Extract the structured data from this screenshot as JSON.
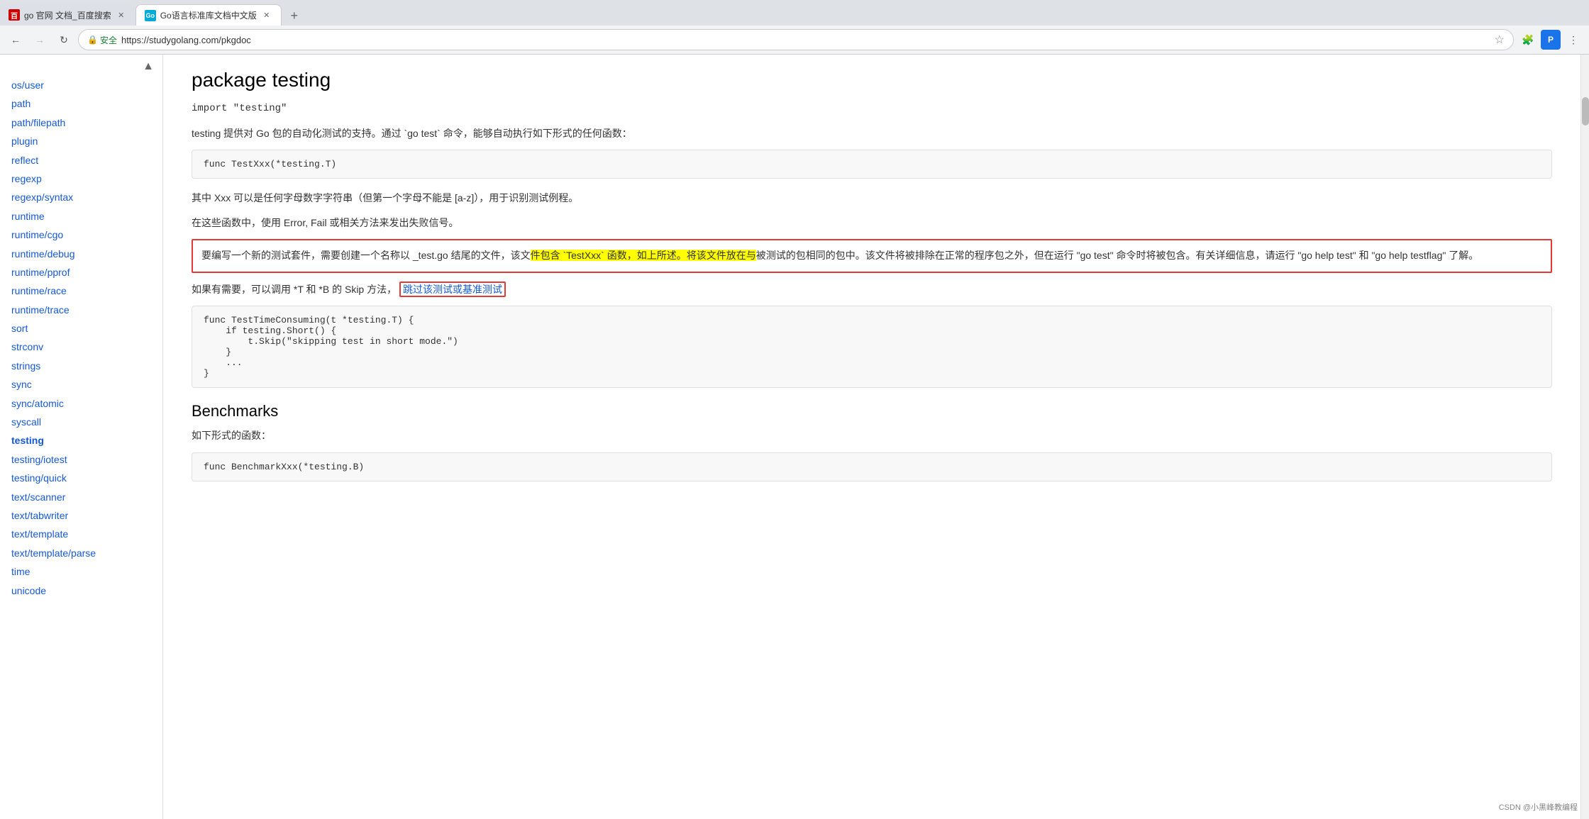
{
  "browser": {
    "tabs": [
      {
        "id": "tab1",
        "label": "go 官网 文档_百度搜索",
        "favicon_type": "baidu",
        "favicon_text": "百",
        "active": false
      },
      {
        "id": "tab2",
        "label": "Go语言标准库文档中文版",
        "favicon_type": "go",
        "favicon_text": "Go",
        "active": true
      }
    ],
    "nav": {
      "back_disabled": false,
      "forward_disabled": true,
      "reload_label": "↻"
    },
    "url": {
      "protocol": "安全",
      "address": "https://studygolang.com/pkgdoc"
    },
    "actions": [
      "star",
      "profile",
      "menu"
    ]
  },
  "sidebar": {
    "up_arrow": "▲",
    "items": [
      {
        "label": "os/user",
        "href": "#",
        "active": false
      },
      {
        "label": "path",
        "href": "#",
        "active": false
      },
      {
        "label": "path/filepath",
        "href": "#",
        "active": false
      },
      {
        "label": "plugin",
        "href": "#",
        "active": false
      },
      {
        "label": "reflect",
        "href": "#",
        "active": false
      },
      {
        "label": "regexp",
        "href": "#",
        "active": false
      },
      {
        "label": "regexp/syntax",
        "href": "#",
        "active": false
      },
      {
        "label": "runtime",
        "href": "#",
        "active": false
      },
      {
        "label": "runtime/cgo",
        "href": "#",
        "active": false
      },
      {
        "label": "runtime/debug",
        "href": "#",
        "active": false
      },
      {
        "label": "runtime/pprof",
        "href": "#",
        "active": false
      },
      {
        "label": "runtime/race",
        "href": "#",
        "active": false
      },
      {
        "label": "runtime/trace",
        "href": "#",
        "active": false
      },
      {
        "label": "sort",
        "href": "#",
        "active": false
      },
      {
        "label": "strconv",
        "href": "#",
        "active": false
      },
      {
        "label": "strings",
        "href": "#",
        "active": false
      },
      {
        "label": "sync",
        "href": "#",
        "active": false
      },
      {
        "label": "sync/atomic",
        "href": "#",
        "active": false
      },
      {
        "label": "syscall",
        "href": "#",
        "active": false
      },
      {
        "label": "testing",
        "href": "#",
        "active": true
      },
      {
        "label": "testing/iotest",
        "href": "#",
        "active": false
      },
      {
        "label": "testing/quick",
        "href": "#",
        "active": false
      },
      {
        "label": "text/scanner",
        "href": "#",
        "active": false
      },
      {
        "label": "text/tabwriter",
        "href": "#",
        "active": false
      },
      {
        "label": "text/template",
        "href": "#",
        "active": false
      },
      {
        "label": "text/template/parse",
        "href": "#",
        "active": false
      },
      {
        "label": "time",
        "href": "#",
        "active": false
      },
      {
        "label": "unicode",
        "href": "#",
        "active": false
      }
    ]
  },
  "content": {
    "package_title": "package testing",
    "import_line": "import \"testing\"",
    "description1": "testing 提供对 Go 包的自动化测试的支持。通过 `go test` 命令，能够自动执行如下形式的任何函数：",
    "code1": "func TestXxx(*testing.T)",
    "description2": "其中 Xxx 可以是任何字母数字字符串（但第一个字母不能是 [a-z]），用于识别测试例程。",
    "description3": "在这些函数中，使用 Error, Fail 或相关方法来发出失败信号。",
    "highlighted_text1": "要编写一个新的测试套件，需要创建一个名称以 _test.go 结尾的文件，该文件包含 `TestXxx` 函数，如上所述。将该文件放在与被测试的包相同的包中。该文件将被排除在正常的程序包之外，但在运行 \"go test\" 命令时将被包含。有关详细信息，请运行 \"go help test\" 和 \"go help testflag\" 了解。",
    "description4_before": "如果有需要，可以调用 *T 和 *B 的 Skip 方法，",
    "link_text": "跳过该测试或基准测试",
    "description4_after": "",
    "code2_lines": [
      "func TestTimeConsuming(t *testing.T) {",
      "    if testing.Short() {",
      "        t.Skip(\"skipping test in short mode.\")",
      "    }",
      "    ...",
      "}"
    ],
    "benchmarks_title": "Benchmarks",
    "benchmarks_description": "如下形式的函数：",
    "code3": "func BenchmarkXxx(*testing.B)",
    "watermark": "CSDN @小黑峰教编程"
  }
}
